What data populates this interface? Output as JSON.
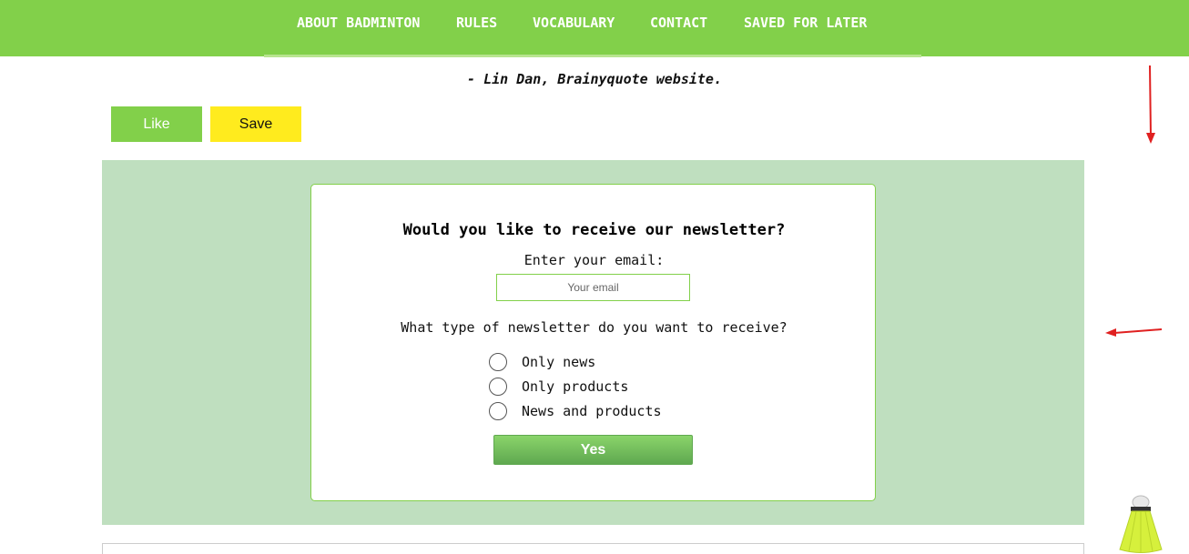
{
  "nav": {
    "items": [
      {
        "label": "ABOUT BADMINTON"
      },
      {
        "label": "RULES"
      },
      {
        "label": "VOCABULARY"
      },
      {
        "label": "CONTACT"
      },
      {
        "label": "SAVED FOR LATER"
      }
    ]
  },
  "quote": {
    "attribution": "- Lin Dan, Brainyquote website."
  },
  "actions": {
    "like_label": "Like",
    "save_label": "Save"
  },
  "newsletter": {
    "title": "Would you like to receive our newsletter?",
    "email_label": "Enter your email:",
    "email_placeholder": "Your email",
    "email_value": "",
    "question": "What type of newsletter do you want to receive?",
    "options": [
      {
        "label": "Only news",
        "selected": false
      },
      {
        "label": "Only products",
        "selected": false
      },
      {
        "label": "News and products",
        "selected": false
      }
    ],
    "submit_label": "Yes"
  },
  "colors": {
    "brand_green": "#82d04a",
    "panel_green": "#bfdfbf",
    "save_yellow": "#ffeb1e",
    "arrow_red": "#e02020"
  },
  "icons": {
    "scroll_hint_down": "arrow-down-icon",
    "scroll_hint_left": "arrow-left-icon",
    "mascot": "shuttlecock-icon"
  }
}
